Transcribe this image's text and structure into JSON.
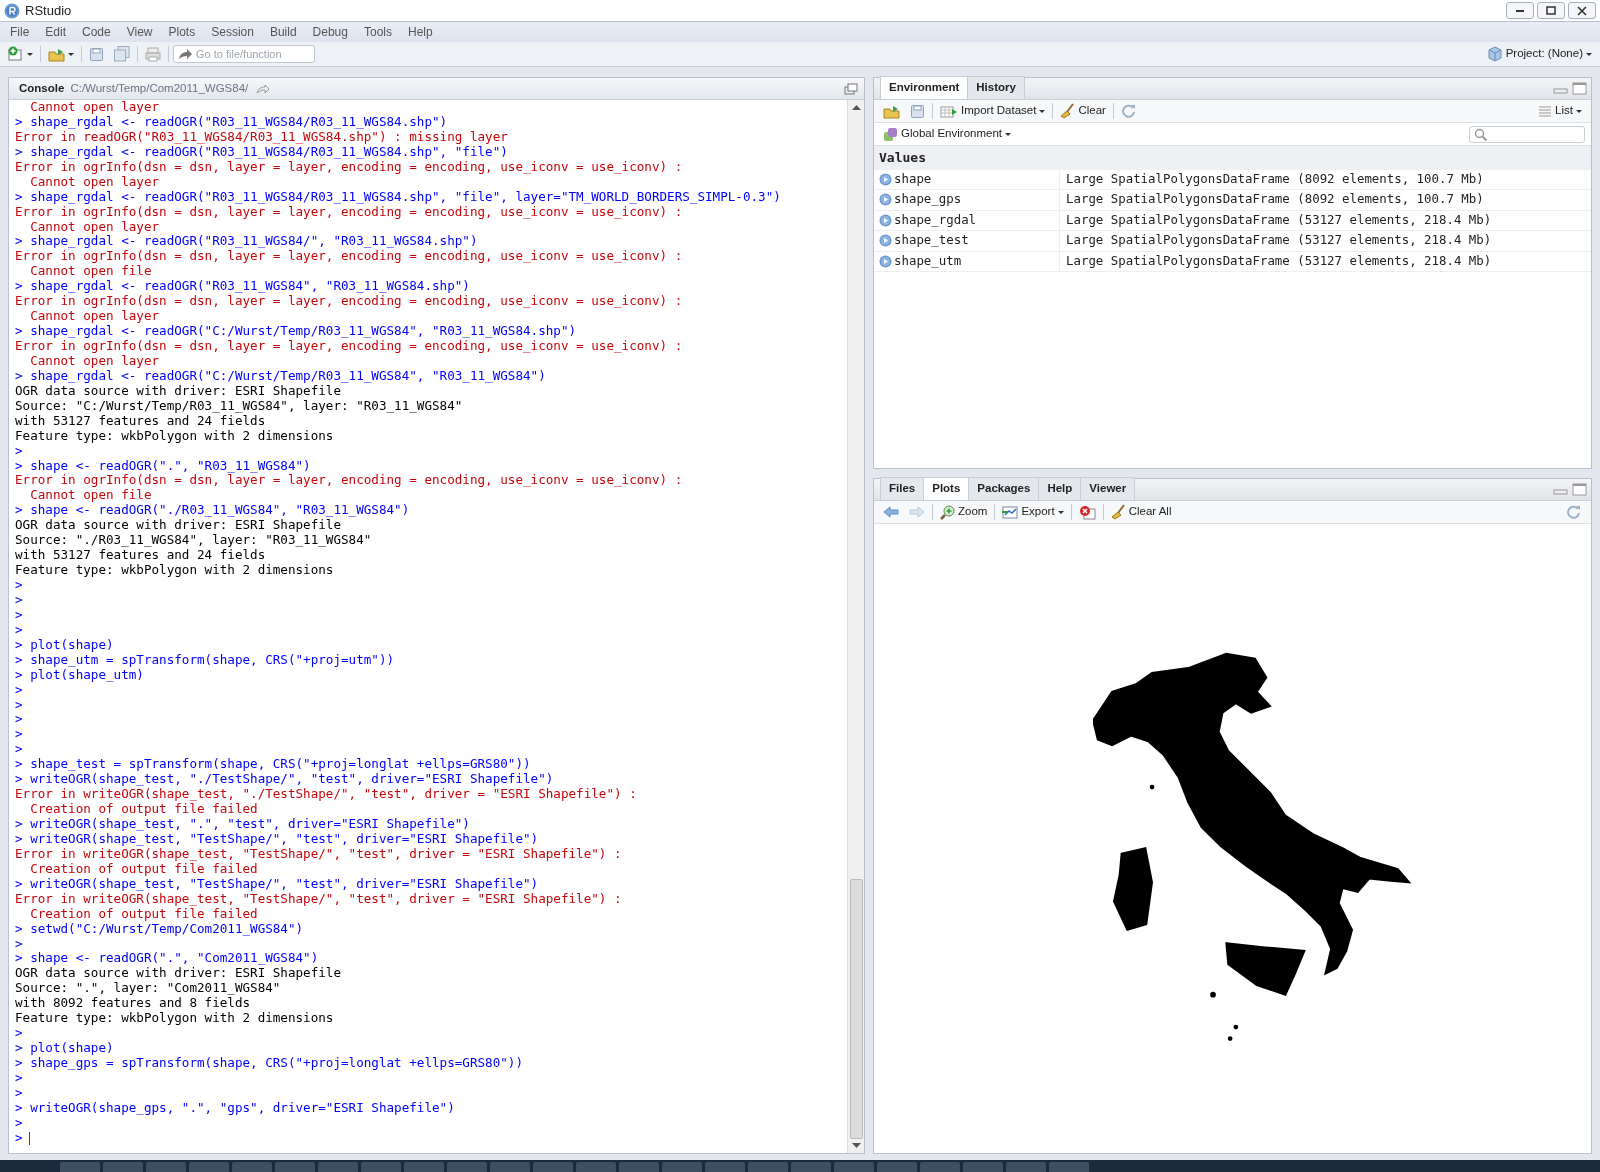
{
  "window": {
    "title": "RStudio",
    "project": "Project: (None)"
  },
  "menu": [
    "File",
    "Edit",
    "Code",
    "View",
    "Plots",
    "Session",
    "Build",
    "Debug",
    "Tools",
    "Help"
  ],
  "toolbar": {
    "goto_placeholder": "Go to file/function"
  },
  "console": {
    "title": "Console",
    "path": "C:/Wurst/Temp/Com2011_WGS84/",
    "lines": [
      {
        "kind": "error",
        "text": "  Cannot open layer"
      },
      {
        "kind": "input",
        "text": "> shape_rgdal <- readOGR(\"R03_11_WGS84/R03_11_WGS84.shp\")"
      },
      {
        "kind": "error",
        "text": "Error in readOGR(\"R03_11_WGS84/R03_11_WGS84.shp\") : missing layer"
      },
      {
        "kind": "input",
        "text": "> shape_rgdal <- readOGR(\"R03_11_WGS84/R03_11_WGS84.shp\", \"file\")"
      },
      {
        "kind": "error",
        "text": "Error in ogrInfo(dsn = dsn, layer = layer, encoding = encoding, use_iconv = use_iconv) :"
      },
      {
        "kind": "error",
        "text": "  Cannot open layer"
      },
      {
        "kind": "input",
        "text": "> shape_rgdal <- readOGR(\"R03_11_WGS84/R03_11_WGS84.shp\", \"file\", layer=\"TM_WORLD_BORDERS_SIMPL-0.3\")"
      },
      {
        "kind": "error",
        "text": "Error in ogrInfo(dsn = dsn, layer = layer, encoding = encoding, use_iconv = use_iconv) :"
      },
      {
        "kind": "error",
        "text": "  Cannot open layer"
      },
      {
        "kind": "input",
        "text": "> shape_rgdal <- readOGR(\"R03_11_WGS84/\", \"R03_11_WGS84.shp\")"
      },
      {
        "kind": "error",
        "text": "Error in ogrInfo(dsn = dsn, layer = layer, encoding = encoding, use_iconv = use_iconv) :"
      },
      {
        "kind": "error",
        "text": "  Cannot open file"
      },
      {
        "kind": "input",
        "text": "> shape_rgdal <- readOGR(\"R03_11_WGS84\", \"R03_11_WGS84.shp\")"
      },
      {
        "kind": "error",
        "text": "Error in ogrInfo(dsn = dsn, layer = layer, encoding = encoding, use_iconv = use_iconv) :"
      },
      {
        "kind": "error",
        "text": "  Cannot open layer"
      },
      {
        "kind": "input",
        "text": "> shape_rgdal <- readOGR(\"C:/Wurst/Temp/R03_11_WGS84\", \"R03_11_WGS84.shp\")"
      },
      {
        "kind": "error",
        "text": "Error in ogrInfo(dsn = dsn, layer = layer, encoding = encoding, use_iconv = use_iconv) :"
      },
      {
        "kind": "error",
        "text": "  Cannot open layer"
      },
      {
        "kind": "input",
        "text": "> shape_rgdal <- readOGR(\"C:/Wurst/Temp/R03_11_WGS84\", \"R03_11_WGS84\")"
      },
      {
        "kind": "output",
        "text": "OGR data source with driver: ESRI Shapefile"
      },
      {
        "kind": "output",
        "text": "Source: \"C:/Wurst/Temp/R03_11_WGS84\", layer: \"R03_11_WGS84\""
      },
      {
        "kind": "output",
        "text": "with 53127 features and 24 fields"
      },
      {
        "kind": "output",
        "text": "Feature type: wkbPolygon with 2 dimensions"
      },
      {
        "kind": "input",
        "text": ">"
      },
      {
        "kind": "input",
        "text": "> shape <- readOGR(\".\", \"R03_11_WGS84\")"
      },
      {
        "kind": "error",
        "text": "Error in ogrInfo(dsn = dsn, layer = layer, encoding = encoding, use_iconv = use_iconv) :"
      },
      {
        "kind": "error",
        "text": "  Cannot open file"
      },
      {
        "kind": "input",
        "text": "> shape <- readOGR(\"./R03_11_WGS84\", \"R03_11_WGS84\")"
      },
      {
        "kind": "output",
        "text": "OGR data source with driver: ESRI Shapefile"
      },
      {
        "kind": "output",
        "text": "Source: \"./R03_11_WGS84\", layer: \"R03_11_WGS84\""
      },
      {
        "kind": "output",
        "text": "with 53127 features and 24 fields"
      },
      {
        "kind": "output",
        "text": "Feature type: wkbPolygon with 2 dimensions"
      },
      {
        "kind": "input",
        "text": ">"
      },
      {
        "kind": "input",
        "text": ">"
      },
      {
        "kind": "input",
        "text": ">"
      },
      {
        "kind": "input",
        "text": ">"
      },
      {
        "kind": "input",
        "text": "> plot(shape)"
      },
      {
        "kind": "input",
        "text": "> shape_utm = spTransform(shape, CRS(\"+proj=utm\"))"
      },
      {
        "kind": "input",
        "text": "> plot(shape_utm)"
      },
      {
        "kind": "input",
        "text": ">"
      },
      {
        "kind": "input",
        "text": ">"
      },
      {
        "kind": "input",
        "text": ">"
      },
      {
        "kind": "input",
        "text": ">"
      },
      {
        "kind": "input",
        "text": ">"
      },
      {
        "kind": "input",
        "text": "> shape_test = spTransform(shape, CRS(\"+proj=longlat +ellps=GRS80\"))"
      },
      {
        "kind": "input",
        "text": "> writeOGR(shape_test, \"./TestShape/\", \"test\", driver=\"ESRI Shapefile\")"
      },
      {
        "kind": "error",
        "text": "Error in writeOGR(shape_test, \"./TestShape/\", \"test\", driver = \"ESRI Shapefile\") :"
      },
      {
        "kind": "error",
        "text": "  Creation of output file failed"
      },
      {
        "kind": "input",
        "text": "> writeOGR(shape_test, \".\", \"test\", driver=\"ESRI Shapefile\")"
      },
      {
        "kind": "input",
        "text": "> writeOGR(shape_test, \"TestShape/\", \"test\", driver=\"ESRI Shapefile\")"
      },
      {
        "kind": "error",
        "text": "Error in writeOGR(shape_test, \"TestShape/\", \"test\", driver = \"ESRI Shapefile\") :"
      },
      {
        "kind": "error",
        "text": "  Creation of output file failed"
      },
      {
        "kind": "input",
        "text": "> writeOGR(shape_test, \"TestShape/\", \"test\", driver=\"ESRI Shapefile\")"
      },
      {
        "kind": "error",
        "text": "Error in writeOGR(shape_test, \"TestShape/\", \"test\", driver = \"ESRI Shapefile\") :"
      },
      {
        "kind": "error",
        "text": "  Creation of output file failed"
      },
      {
        "kind": "input",
        "text": "> setwd(\"C:/Wurst/Temp/Com2011_WGS84\")"
      },
      {
        "kind": "input",
        "text": ">"
      },
      {
        "kind": "input",
        "text": "> shape <- readOGR(\".\", \"Com2011_WGS84\")"
      },
      {
        "kind": "output",
        "text": "OGR data source with driver: ESRI Shapefile"
      },
      {
        "kind": "output",
        "text": "Source: \".\", layer: \"Com2011_WGS84\""
      },
      {
        "kind": "output",
        "text": "with 8092 features and 8 fields"
      },
      {
        "kind": "output",
        "text": "Feature type: wkbPolygon with 2 dimensions"
      },
      {
        "kind": "input",
        "text": ">"
      },
      {
        "kind": "input",
        "text": "> plot(shape)"
      },
      {
        "kind": "input",
        "text": "> shape_gps = spTransform(shape, CRS(\"+proj=longlat +ellps=GRS80\"))"
      },
      {
        "kind": "input",
        "text": ">"
      },
      {
        "kind": "input",
        "text": ">"
      },
      {
        "kind": "input",
        "text": "> writeOGR(shape_gps, \".\", \"gps\", driver=\"ESRI Shapefile\")"
      },
      {
        "kind": "input",
        "text": ">"
      },
      {
        "kind": "prompt",
        "text": ">"
      }
    ]
  },
  "environment": {
    "tabs": [
      {
        "label": "Environment",
        "selected": true
      },
      {
        "label": "History",
        "selected": false
      }
    ],
    "import": "Import Dataset",
    "clear": "Clear",
    "view": "List",
    "scope": "Global Environment",
    "section": "Values",
    "rows": [
      {
        "name": "shape",
        "value": "Large SpatialPolygonsDataFrame (8092 elements, 100.7 Mb)"
      },
      {
        "name": "shape_gps",
        "value": "Large SpatialPolygonsDataFrame (8092 elements, 100.7 Mb)"
      },
      {
        "name": "shape_rgdal",
        "value": "Large SpatialPolygonsDataFrame (53127 elements, 218.4 Mb)"
      },
      {
        "name": "shape_test",
        "value": "Large SpatialPolygonsDataFrame (53127 elements, 218.4 Mb)"
      },
      {
        "name": "shape_utm",
        "value": "Large SpatialPolygonsDataFrame (53127 elements, 218.4 Mb)"
      }
    ]
  },
  "plots_pane": {
    "tabs": [
      {
        "label": "Files",
        "selected": false
      },
      {
        "label": "Plots",
        "selected": true
      },
      {
        "label": "Packages",
        "selected": false
      },
      {
        "label": "Help",
        "selected": false
      },
      {
        "label": "Viewer",
        "selected": false
      }
    ],
    "zoom": "Zoom",
    "export": "Export",
    "clear_all": "Clear All"
  }
}
